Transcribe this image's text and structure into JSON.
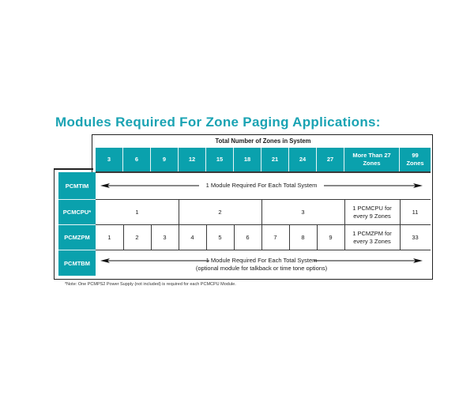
{
  "title": "Modules Required For Zone Paging Applications:",
  "table": {
    "header_title": "Total Number of Zones in System",
    "columns": [
      "3",
      "6",
      "9",
      "12",
      "15",
      "18",
      "21",
      "24",
      "27",
      "More Than 27 Zones",
      "99 Zones"
    ],
    "columns_lines": [
      [
        "3"
      ],
      [
        "6"
      ],
      [
        "9"
      ],
      [
        "12"
      ],
      [
        "15"
      ],
      [
        "18"
      ],
      [
        "21"
      ],
      [
        "24"
      ],
      [
        "27"
      ],
      [
        "More Than 27",
        "Zones"
      ],
      [
        "99",
        "Zones"
      ]
    ],
    "rows": [
      {
        "label": "PCMTIM",
        "type": "span-arrow",
        "text": "1 Module Required For Each Total System"
      },
      {
        "label": "PCMCPU*",
        "type": "groups",
        "cells": [
          "1",
          "2",
          "3",
          "1 PCMCPU for every 9 Zones",
          "11"
        ],
        "cell_lines": [
          [
            "1"
          ],
          [
            "2"
          ],
          [
            "3"
          ],
          [
            "1 PCMCPU for",
            "every 9 Zones"
          ],
          [
            "11"
          ]
        ]
      },
      {
        "label": "PCMZPM",
        "type": "cells",
        "cells": [
          "1",
          "2",
          "3",
          "4",
          "5",
          "6",
          "7",
          "8",
          "9",
          "1 PCMZPM for every 3 Zones",
          "33"
        ],
        "cell_lines": [
          [
            "1"
          ],
          [
            "2"
          ],
          [
            "3"
          ],
          [
            "4"
          ],
          [
            "5"
          ],
          [
            "6"
          ],
          [
            "7"
          ],
          [
            "8"
          ],
          [
            "9"
          ],
          [
            "1 PCMZPM for",
            "every 3 Zones"
          ],
          [
            "33"
          ]
        ]
      },
      {
        "label": "PCMTBM",
        "type": "span-arrow",
        "text": "1 Module Required For Each Total System",
        "subtext": "(optional module for talkback or time tone options)"
      }
    ]
  },
  "note": "*Note: One PCMPS2 Power Supply (not included) is required for each PCMCPU Module.",
  "colors": {
    "accent": "#0aa1ad",
    "title": "#1aa3b3"
  },
  "icons": {
    "arrow_left": "arrow-left-icon",
    "arrow_right": "arrow-right-icon"
  }
}
